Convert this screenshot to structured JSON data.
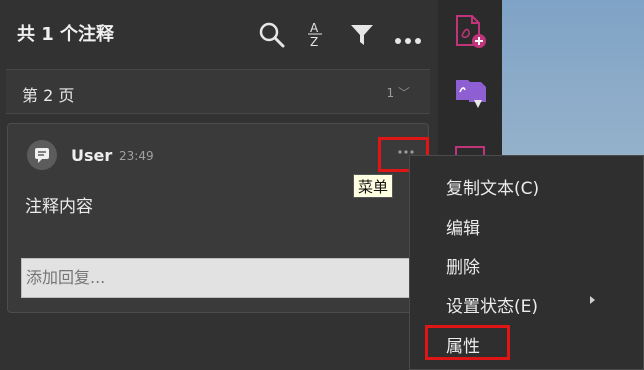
{
  "header": {
    "title": "共 1 个注释"
  },
  "filter": {
    "page_label": "第 2 页",
    "page_number": "1"
  },
  "comment": {
    "user": "User",
    "time": "23:49",
    "content": "注释内容",
    "reply_placeholder": "添加回复..."
  },
  "tooltip": {
    "text": "菜单"
  },
  "context_menu": {
    "items": [
      {
        "label": "复制文本(C)"
      },
      {
        "label": "编辑"
      },
      {
        "label": "删除"
      },
      {
        "label": "设置状态(E)"
      },
      {
        "label": "属性"
      }
    ]
  },
  "colors": {
    "highlight": "#e01515",
    "accent_tool": "#c0357a",
    "panel_bg": "#323232"
  },
  "icons": [
    "search-icon",
    "sort-az-icon",
    "filter-icon",
    "more-options-icon",
    "comment-avatar-icon",
    "add-pdf-icon",
    "export-pdf-icon"
  ]
}
